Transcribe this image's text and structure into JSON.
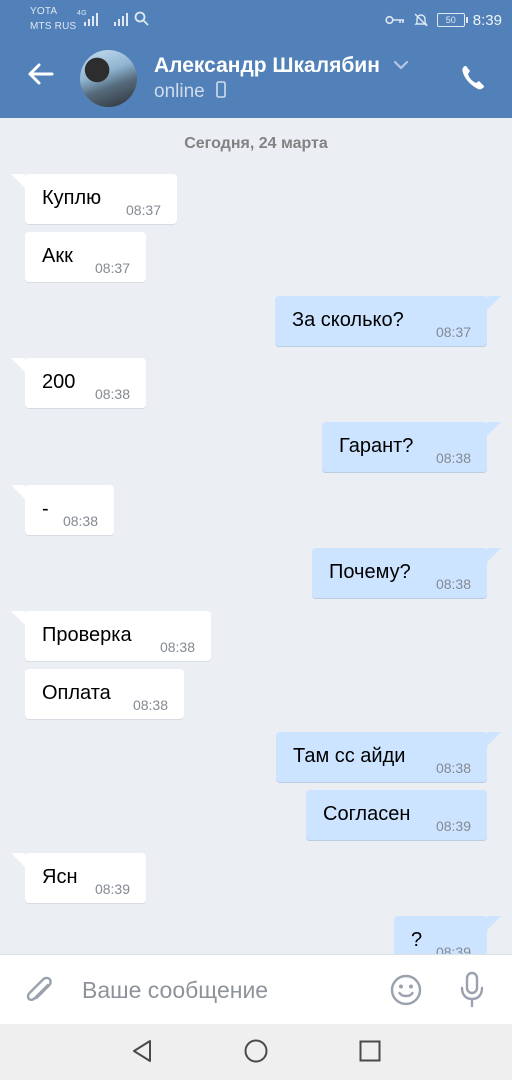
{
  "statusbar": {
    "carrier1": "YOTA",
    "carrier2": "MTS RUS",
    "net_type": "4G",
    "battery": "50",
    "time": "8:39"
  },
  "header": {
    "contact_name": "Александр Шкалябин",
    "presence": "online",
    "icons": [
      "back-arrow-icon",
      "avatar",
      "chevron-down-icon",
      "mobile-icon",
      "phone-icon"
    ]
  },
  "chat": {
    "date_separator": "Сегодня, 24 марта",
    "messages": [
      {
        "dir": "in",
        "text": "Куплю",
        "time": "08:37"
      },
      {
        "dir": "in",
        "text": "Акк",
        "time": "08:37"
      },
      {
        "dir": "out",
        "text": "За сколько?",
        "time": "08:37"
      },
      {
        "dir": "in",
        "text": "200",
        "time": "08:38"
      },
      {
        "dir": "out",
        "text": "Гарант?",
        "time": "08:38"
      },
      {
        "dir": "in",
        "text": "-",
        "time": "08:38"
      },
      {
        "dir": "out",
        "text": "Почему?",
        "time": "08:38"
      },
      {
        "dir": "in",
        "text": "Проверка",
        "time": "08:38"
      },
      {
        "dir": "in",
        "text": "Оплата",
        "time": "08:38"
      },
      {
        "dir": "out",
        "text": "Там сс айди",
        "time": "08:38"
      },
      {
        "dir": "out",
        "text": "Согласен",
        "time": "08:39"
      },
      {
        "dir": "in",
        "text": "Ясн",
        "time": "08:39"
      },
      {
        "dir": "out",
        "text": "?",
        "time": "08:39"
      }
    ]
  },
  "composer": {
    "placeholder": "Ваше сообщение",
    "icons": [
      "paperclip-icon",
      "emoji-icon",
      "microphone-icon"
    ]
  },
  "navbar": {
    "icons": [
      "nav-back-icon",
      "nav-home-icon",
      "nav-recents-icon"
    ]
  },
  "colors": {
    "header_bg": "#5181b8",
    "chat_bg": "#ebeef2",
    "incoming_bubble": "#ffffff",
    "outgoing_bubble": "#cce4ff"
  }
}
